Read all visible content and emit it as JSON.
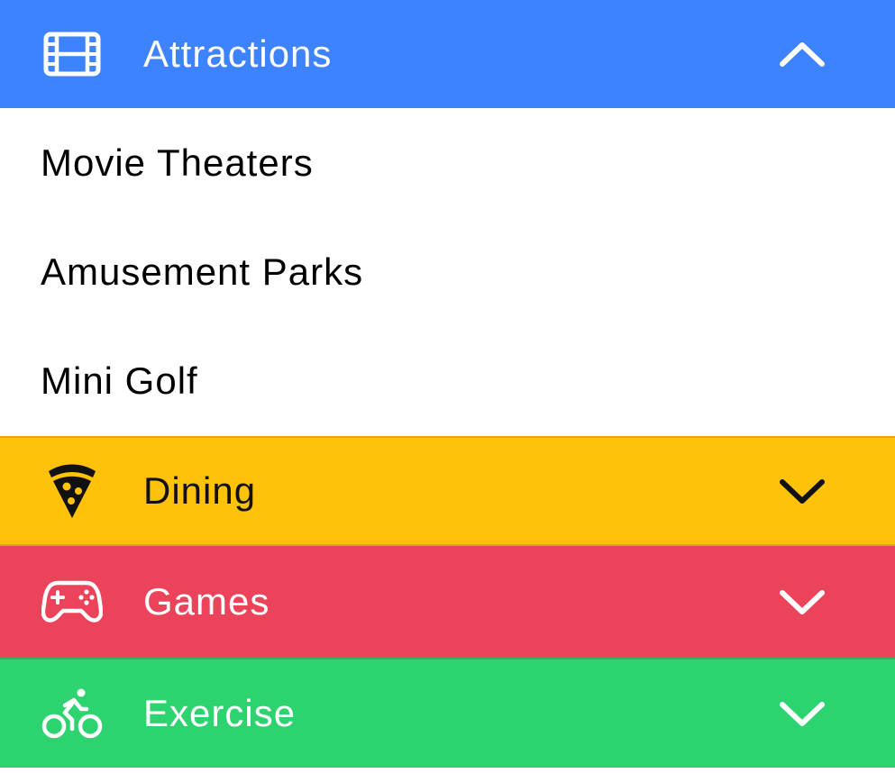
{
  "sections": [
    {
      "title": "Attractions",
      "icon": "film-icon",
      "color": "#3d82fe",
      "expanded": true,
      "chevron": "chevron-up-icon",
      "items": [
        "Movie Theaters",
        "Amusement Parks",
        "Mini Golf"
      ]
    },
    {
      "title": "Dining",
      "icon": "pizza-icon",
      "color": "#ffc20a",
      "expanded": false,
      "chevron": "chevron-down-icon"
    },
    {
      "title": "Games",
      "icon": "game-controller-icon",
      "color": "#eb445a",
      "expanded": false,
      "chevron": "chevron-down-icon"
    },
    {
      "title": "Exercise",
      "icon": "bicycle-icon",
      "color": "#2dd36f",
      "expanded": false,
      "chevron": "chevron-down-icon"
    }
  ]
}
